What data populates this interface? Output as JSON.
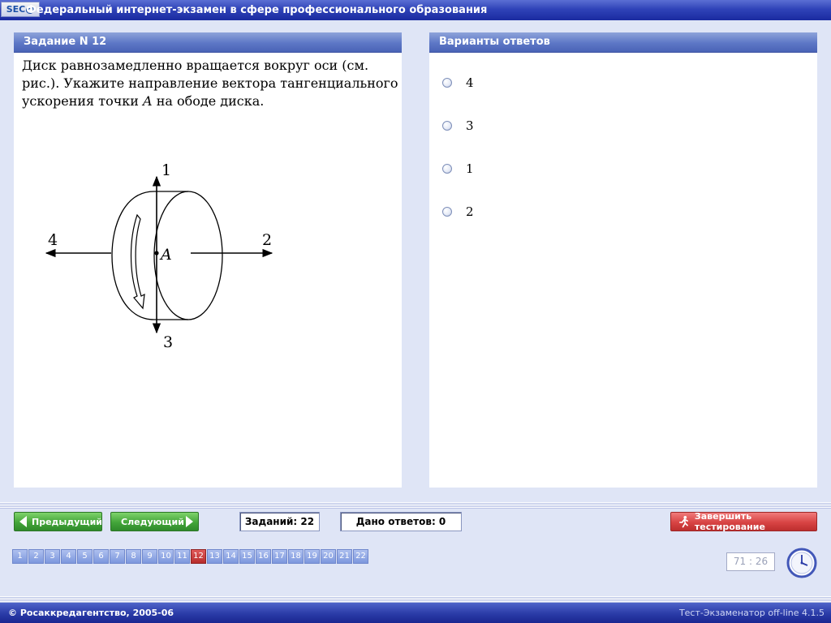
{
  "app": {
    "logo_text": "SEC@",
    "title": "Федеральный интернет-экзамен в сфере профессионального образования"
  },
  "question_panel": {
    "header": "Задание N 12",
    "text_before_var": "Диск равнозамедленно вращается вокруг оси (см. рис.). Укажите направление вектора тангенциального ускорения точки ",
    "var_name": "A",
    "text_after_var": " на ободе диска.",
    "figure": {
      "labels": {
        "up": "1",
        "right": "2",
        "down": "3",
        "left": "4",
        "point": "A"
      }
    }
  },
  "answers_panel": {
    "header": "Варианты ответов",
    "options": [
      {
        "label": "4"
      },
      {
        "label": "3"
      },
      {
        "label": "1"
      },
      {
        "label": "2"
      }
    ]
  },
  "navigation": {
    "prev_label": "Предыдущий",
    "next_label": "Следующий",
    "tasks_count_text": "Заданий: 22",
    "answers_given_text": "Дано ответов: 0",
    "finish_label": "Завершить тестирование",
    "pages": [
      "1",
      "2",
      "3",
      "4",
      "5",
      "6",
      "7",
      "8",
      "9",
      "10",
      "11",
      "12",
      "13",
      "14",
      "15",
      "16",
      "17",
      "18",
      "19",
      "20",
      "21",
      "22"
    ],
    "current_page": "12"
  },
  "timer": {
    "value": "71 : 26"
  },
  "footer": {
    "copyright": "© Росаккредагентство, 2005-06",
    "version": "Тест-Экзаменатор off-line 4.1.5"
  },
  "colors": {
    "background": "#dfe5f6",
    "panel_header": "#5d77c6",
    "nav_green": "#43a53a",
    "finish_red": "#d84444",
    "active_page": "#b72c2c"
  }
}
